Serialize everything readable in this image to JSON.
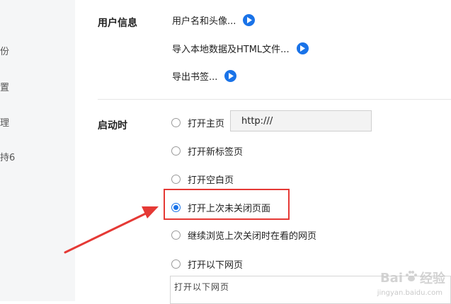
{
  "sidebar": {
    "items": [
      {
        "label": "份"
      },
      {
        "label": "置"
      },
      {
        "label": "理"
      },
      {
        "label": "持6"
      }
    ]
  },
  "user_info": {
    "title": "用户信息",
    "links": [
      {
        "label": "用户名和头像..."
      },
      {
        "label": "导入本地数据及HTML文件..."
      },
      {
        "label": "导出书签..."
      }
    ]
  },
  "startup": {
    "title": "启动时",
    "url_value": "http:///",
    "options": [
      {
        "label": "打开主页",
        "checked": false
      },
      {
        "label": "打开新标签页",
        "checked": false
      },
      {
        "label": "打开空白页",
        "checked": false
      },
      {
        "label": "打开上次未关闭页面",
        "checked": true
      },
      {
        "label": "继续浏览上次关闭时在看的网页",
        "checked": false
      },
      {
        "label": "打开以下网页",
        "checked": false
      }
    ],
    "textarea_value": "打开以下网页"
  },
  "annotation": {
    "color": "#e53935"
  },
  "watermark": {
    "brand": "Bai",
    "brand_suffix": "经验",
    "url": "jingyan.baidu.com"
  },
  "colors": {
    "accent": "#1a73e8",
    "sidebar_bg": "#f5f6f7"
  }
}
